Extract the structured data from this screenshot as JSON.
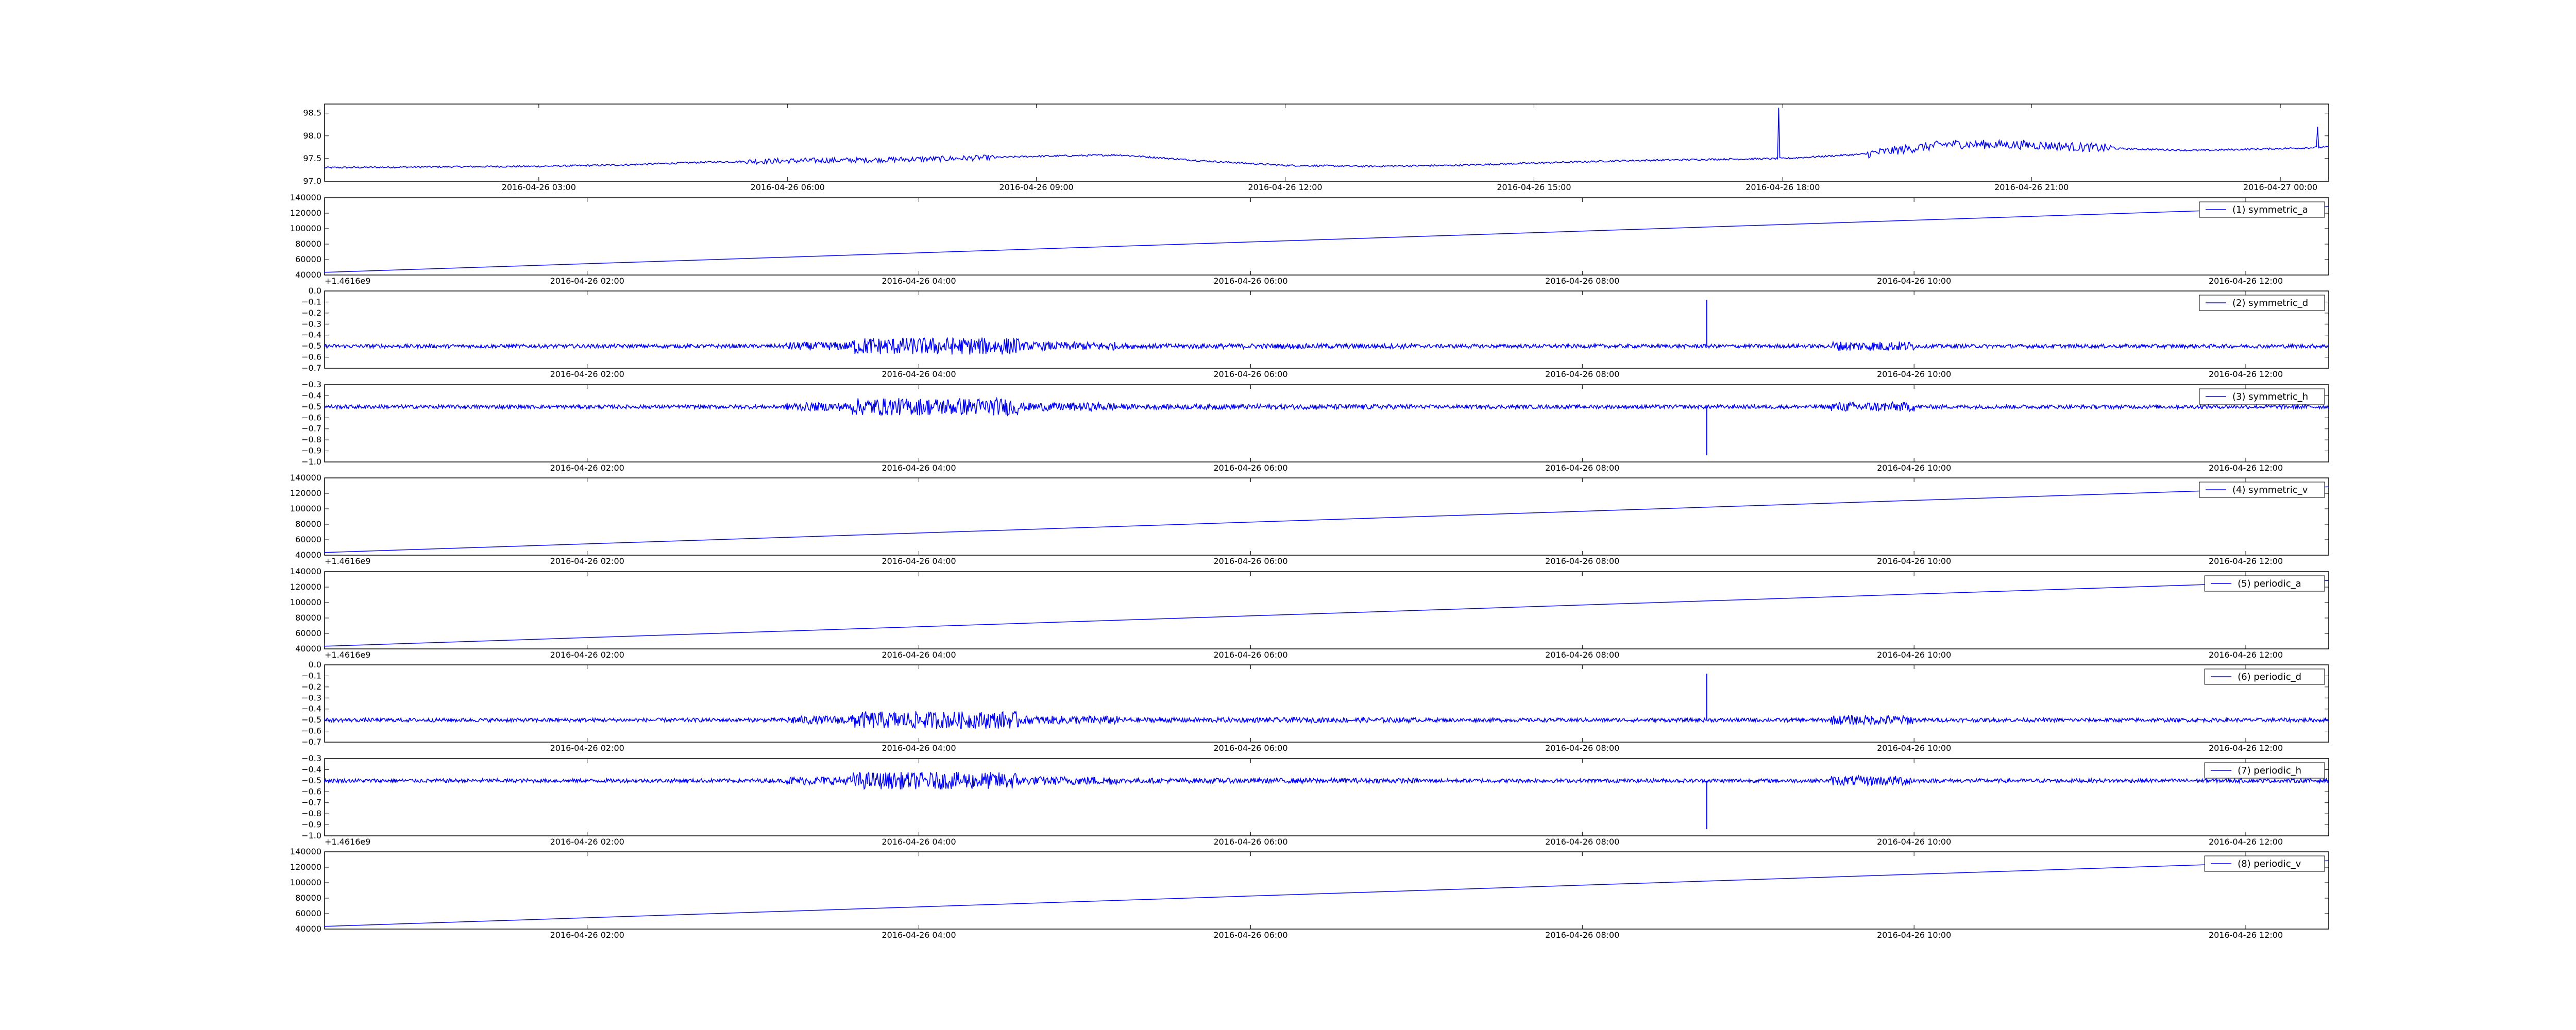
{
  "colors": {
    "line": "#0000ff",
    "axes": "#000000",
    "background": "#ffffff"
  },
  "chart_data": [
    {
      "type": "line",
      "x_axis": "datetime",
      "xlim": [
        "2016-04-26 00:25",
        "2016-04-27 00:35"
      ],
      "ylim": [
        97.0,
        98.7
      ],
      "y_ticks": [
        97.0,
        97.5,
        98.0,
        98.5
      ],
      "y_tick_labels": [
        "97.0",
        "97.5",
        "98.0",
        "98.5"
      ],
      "x_tick_labels": [
        "2016-04-26 03:00",
        "2016-04-26 06:00",
        "2016-04-26 09:00",
        "2016-04-26 12:00",
        "2016-04-26 15:00",
        "2016-04-26 18:00",
        "2016-04-26 21:00",
        "2016-04-27 00:00"
      ],
      "offset_text": "",
      "legend": "",
      "grid": false,
      "series": [
        {
          "x": [
            "2016-04-26 00:25",
            "2016-04-26 02:00",
            "2016-04-26 03:00",
            "2016-04-26 04:00",
            "2016-04-26 05:00",
            "2016-04-26 06:00",
            "2016-04-26 07:00",
            "2016-04-26 08:00",
            "2016-04-26 09:00",
            "2016-04-26 10:00",
            "2016-04-26 11:00",
            "2016-04-26 12:00",
            "2016-04-26 13:00",
            "2016-04-26 14:00",
            "2016-04-26 15:00",
            "2016-04-26 16:00",
            "2016-04-26 17:00",
            "2016-04-26 18:00",
            "2016-04-26 19:00",
            "2016-04-26 20:00",
            "2016-04-26 21:00",
            "2016-04-26 22:00",
            "2016-04-26 23:00",
            "2016-04-27 00:00",
            "2016-04-27 00:35"
          ],
          "values": [
            97.3,
            97.32,
            97.33,
            97.36,
            97.42,
            97.45,
            97.47,
            97.5,
            97.55,
            97.58,
            97.45,
            97.35,
            97.33,
            97.35,
            97.4,
            97.45,
            97.48,
            97.5,
            97.6,
            97.82,
            97.8,
            97.72,
            97.68,
            97.72,
            97.75
          ]
        }
      ]
    },
    {
      "type": "line",
      "x_axis": "datetime",
      "xlim": [
        "2016-04-26 00:25",
        "2016-04-26 12:30"
      ],
      "ylim": [
        40000,
        140000
      ],
      "y_ticks": [
        40000,
        60000,
        80000,
        100000,
        120000,
        140000
      ],
      "y_tick_labels": [
        "40000",
        "60000",
        "80000",
        "100000",
        "120000",
        "140000"
      ],
      "x_tick_labels": [
        "2016-04-26 02:00",
        "2016-04-26 04:00",
        "2016-04-26 06:00",
        "2016-04-26 08:00",
        "2016-04-26 10:00",
        "2016-04-26 12:00"
      ],
      "offset_text": "+1.4616e9",
      "legend": "(1) symmetric_a",
      "grid": false,
      "series": [
        {
          "name": "(1) symmetric_a",
          "x": [
            "2016-04-26 00:25",
            "2016-04-26 12:30"
          ],
          "values": [
            43500,
            128500
          ]
        }
      ]
    },
    {
      "type": "line",
      "x_axis": "datetime",
      "xlim": [
        "2016-04-26 00:25",
        "2016-04-26 12:30"
      ],
      "ylim": [
        -0.7,
        0.0
      ],
      "y_ticks": [
        -0.7,
        -0.6,
        -0.5,
        -0.4,
        -0.3,
        -0.2,
        -0.1,
        0.0
      ],
      "y_tick_labels": [
        "−0.7",
        "−0.6",
        "−0.5",
        "−0.4",
        "−0.3",
        "−0.2",
        "−0.1",
        "0.0"
      ],
      "x_tick_labels": [
        "2016-04-26 02:00",
        "2016-04-26 04:00",
        "2016-04-26 06:00",
        "2016-04-26 08:00",
        "2016-04-26 10:00",
        "2016-04-26 12:00"
      ],
      "offset_text": "",
      "legend": "(2) symmetric_d",
      "grid": false,
      "series": [
        {
          "name": "(2) symmetric_d",
          "baseline": -0.5,
          "spike": {
            "x": "2016-04-26 08:45",
            "peak": -0.08
          }
        }
      ]
    },
    {
      "type": "line",
      "x_axis": "datetime",
      "xlim": [
        "2016-04-26 00:25",
        "2016-04-26 12:30"
      ],
      "ylim": [
        -1.0,
        -0.3
      ],
      "y_ticks": [
        -1.0,
        -0.9,
        -0.8,
        -0.7,
        -0.6,
        -0.5,
        -0.4,
        -0.3
      ],
      "y_tick_labels": [
        "−1.0",
        "−0.9",
        "−0.8",
        "−0.7",
        "−0.6",
        "−0.5",
        "−0.4",
        "−0.3"
      ],
      "x_tick_labels": [
        "2016-04-26 02:00",
        "2016-04-26 04:00",
        "2016-04-26 06:00",
        "2016-04-26 08:00",
        "2016-04-26 10:00",
        "2016-04-26 12:00"
      ],
      "offset_text": "",
      "legend": "(3) symmetric_h",
      "grid": false,
      "series": [
        {
          "name": "(3) symmetric_h",
          "baseline": -0.5,
          "spike": {
            "x": "2016-04-26 08:45",
            "peak": -0.94
          }
        }
      ]
    },
    {
      "type": "line",
      "x_axis": "datetime",
      "xlim": [
        "2016-04-26 00:25",
        "2016-04-26 12:30"
      ],
      "ylim": [
        40000,
        140000
      ],
      "y_ticks": [
        40000,
        60000,
        80000,
        100000,
        120000,
        140000
      ],
      "y_tick_labels": [
        "40000",
        "60000",
        "80000",
        "100000",
        "120000",
        "140000"
      ],
      "x_tick_labels": [
        "2016-04-26 02:00",
        "2016-04-26 04:00",
        "2016-04-26 06:00",
        "2016-04-26 08:00",
        "2016-04-26 10:00",
        "2016-04-26 12:00"
      ],
      "offset_text": "+1.4616e9",
      "legend": "(4) symmetric_v",
      "grid": false,
      "series": [
        {
          "name": "(4) symmetric_v",
          "x": [
            "2016-04-26 00:25",
            "2016-04-26 12:30"
          ],
          "values": [
            43500,
            128500
          ]
        }
      ]
    },
    {
      "type": "line",
      "x_axis": "datetime",
      "xlim": [
        "2016-04-26 00:25",
        "2016-04-26 12:30"
      ],
      "ylim": [
        40000,
        140000
      ],
      "y_ticks": [
        40000,
        60000,
        80000,
        100000,
        120000,
        140000
      ],
      "y_tick_labels": [
        "40000",
        "60000",
        "80000",
        "100000",
        "120000",
        "140000"
      ],
      "x_tick_labels": [
        "2016-04-26 02:00",
        "2016-04-26 04:00",
        "2016-04-26 06:00",
        "2016-04-26 08:00",
        "2016-04-26 10:00",
        "2016-04-26 12:00"
      ],
      "offset_text": "+1.4616e9",
      "legend": "(5) periodic_a",
      "grid": false,
      "series": [
        {
          "name": "(5) periodic_a",
          "x": [
            "2016-04-26 00:25",
            "2016-04-26 12:30"
          ],
          "values": [
            43500,
            128500
          ]
        }
      ]
    },
    {
      "type": "line",
      "x_axis": "datetime",
      "xlim": [
        "2016-04-26 00:25",
        "2016-04-26 12:30"
      ],
      "ylim": [
        -0.7,
        0.0
      ],
      "y_ticks": [
        -0.7,
        -0.6,
        -0.5,
        -0.4,
        -0.3,
        -0.2,
        -0.1,
        0.0
      ],
      "y_tick_labels": [
        "−0.7",
        "−0.6",
        "−0.5",
        "−0.4",
        "−0.3",
        "−0.2",
        "−0.1",
        "0.0"
      ],
      "x_tick_labels": [
        "2016-04-26 02:00",
        "2016-04-26 04:00",
        "2016-04-26 06:00",
        "2016-04-26 08:00",
        "2016-04-26 10:00",
        "2016-04-26 12:00"
      ],
      "offset_text": "",
      "legend": "(6) periodic_d",
      "grid": false,
      "series": [
        {
          "name": "(6) periodic_d",
          "baseline": -0.5,
          "spike": {
            "x": "2016-04-26 08:45",
            "peak": -0.08
          }
        }
      ]
    },
    {
      "type": "line",
      "x_axis": "datetime",
      "xlim": [
        "2016-04-26 00:25",
        "2016-04-26 12:30"
      ],
      "ylim": [
        -1.0,
        -0.3
      ],
      "y_ticks": [
        -1.0,
        -0.9,
        -0.8,
        -0.7,
        -0.6,
        -0.5,
        -0.4,
        -0.3
      ],
      "y_tick_labels": [
        "−1.0",
        "−0.9",
        "−0.8",
        "−0.7",
        "−0.6",
        "−0.5",
        "−0.4",
        "−0.3"
      ],
      "x_tick_labels": [
        "2016-04-26 02:00",
        "2016-04-26 04:00",
        "2016-04-26 06:00",
        "2016-04-26 08:00",
        "2016-04-26 10:00",
        "2016-04-26 12:00"
      ],
      "offset_text": "+1.4616e9",
      "legend": "(7) periodic_h",
      "grid": false,
      "series": [
        {
          "name": "(7) periodic_h",
          "baseline": -0.5,
          "spike": {
            "x": "2016-04-26 08:45",
            "peak": -0.94
          }
        }
      ]
    },
    {
      "type": "line",
      "x_axis": "datetime",
      "xlim": [
        "2016-04-26 00:25",
        "2016-04-26 12:30"
      ],
      "ylim": [
        40000,
        140000
      ],
      "y_ticks": [
        40000,
        60000,
        80000,
        100000,
        120000,
        140000
      ],
      "y_tick_labels": [
        "40000",
        "60000",
        "80000",
        "100000",
        "120000",
        "140000"
      ],
      "x_tick_labels": [
        "2016-04-26 02:00",
        "2016-04-26 04:00",
        "2016-04-26 06:00",
        "2016-04-26 08:00",
        "2016-04-26 10:00",
        "2016-04-26 12:00"
      ],
      "offset_text": "",
      "legend": "(8) periodic_v",
      "grid": false,
      "series": [
        {
          "name": "(8) periodic_v",
          "x": [
            "2016-04-26 00:25",
            "2016-04-26 12:30"
          ],
          "values": [
            43500,
            128500
          ]
        }
      ]
    }
  ]
}
